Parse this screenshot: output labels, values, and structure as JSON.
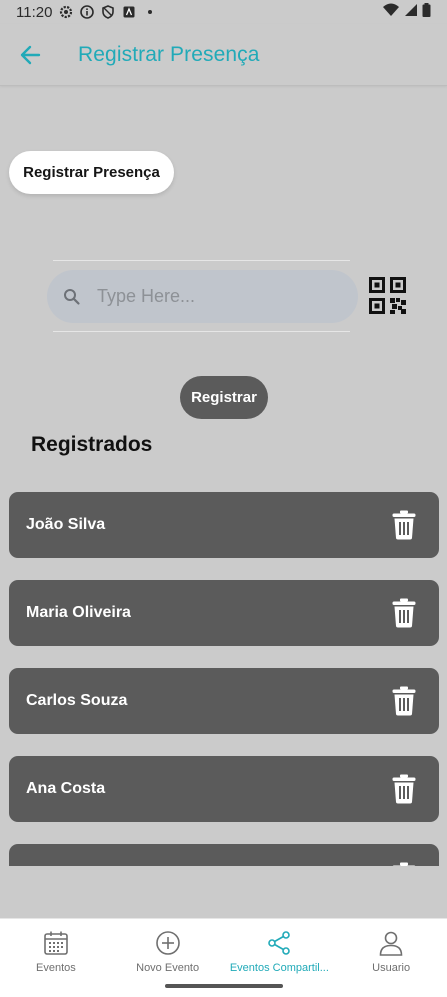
{
  "status": {
    "time": "11:20"
  },
  "header": {
    "title": "Registrar Presença"
  },
  "label_chip": "Registrar Presença",
  "search": {
    "placeholder": "Type Here..."
  },
  "register_button": "Registrar",
  "section_title": "Registrados",
  "registered": [
    "João Silva",
    "Maria Oliveira",
    "Carlos Souza",
    "Ana Costa",
    ""
  ],
  "nav": [
    {
      "label": "Eventos",
      "icon": "calendar-icon",
      "active": false
    },
    {
      "label": "Novo Evento",
      "icon": "plus-circle-icon",
      "active": false
    },
    {
      "label": "Eventos Compartil...",
      "icon": "share-icon",
      "active": true
    },
    {
      "label": "Usuario",
      "icon": "user-icon",
      "active": false
    }
  ],
  "colors": {
    "accent": "#21aab8",
    "background": "#cbcbcb",
    "card": "#5b5b5b"
  }
}
